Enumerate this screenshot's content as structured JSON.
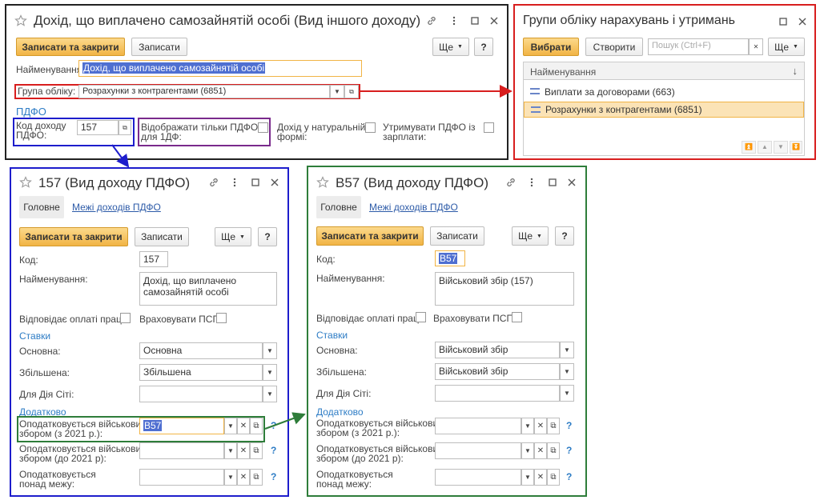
{
  "main_window": {
    "title": "Дохід, що виплачено самозайнятій особі (Вид іншого доходу)",
    "save_close": "Записати та закрити",
    "save": "Записати",
    "more": "Ще",
    "help": "?",
    "name_label": "Найменування:",
    "name_value": "Дохід, що виплачено самозайнятій особі",
    "group_label": "Група обліку:",
    "group_value": "Розрахунки з контрагентами (6851)",
    "pdfo_section": "ПДФО",
    "pdfo_code_label_1": "Код доходу",
    "pdfo_code_label_2": "ПДФО:",
    "pdfo_code_value": "157",
    "show_only_label_1": "Відображати тільки ПДФО",
    "show_only_label_2": "для 1ДФ:",
    "natural_label_1": "Дохід у натуральній",
    "natural_label_2": "формі:",
    "withhold_label_1": "Утримувати ПДФО із",
    "withhold_label_2": "зарплати:"
  },
  "groups_window": {
    "title": "Групи обліку нарахувань і утримань",
    "select": "Вибрати",
    "create": "Створити",
    "search_placeholder": "Пошук (Ctrl+F)",
    "more": "Ще",
    "column": "Найменування",
    "rows": [
      {
        "label": "Виплати за договорами (663)"
      },
      {
        "label": "Розрахунки з контрагентами (6851)"
      }
    ]
  },
  "win157": {
    "title": "157 (Вид доходу ПДФО)",
    "tab_main": "Головне",
    "tab_limits": "Межі доходів ПДФО",
    "save_close": "Записати та закрити",
    "save": "Записати",
    "more": "Ще",
    "help": "?",
    "code_label": "Код:",
    "code_value": "157",
    "name_label": "Найменування:",
    "name_line1": "Дохід, що виплачено",
    "name_line2": "самозайнятій особі",
    "wage_label": "Відповідає оплаті праці:",
    "psp_label": "Враховувати ПСП:",
    "rates_section": "Ставки",
    "basic_label": "Основна:",
    "basic_value": "Основна",
    "increased_label": "Збільшена:",
    "increased_value": "Збільшена",
    "diya_label": "Для Дія Сіті:",
    "extra_section": "Додатково",
    "mil2021_label_1": "Оподатковується військовим",
    "mil2021_label_2": "збором (з 2021 р.):",
    "mil2021_value": "В57",
    "milpre_label_1": "Оподатковується військовим",
    "milpre_label_2": "збором (до 2021 р):",
    "over_label_1": "Оподатковується",
    "over_label_2": "понад межу:"
  },
  "winB57": {
    "title": "В57 (Вид доходу ПДФО)",
    "tab_main": "Головне",
    "tab_limits": "Межі доходів ПДФО",
    "save_close": "Записати та закрити",
    "save": "Записати",
    "more": "Ще",
    "help": "?",
    "code_label": "Код:",
    "code_value": "В57",
    "name_label": "Найменування:",
    "name_line1": "Військовий збір (157)",
    "wage_label": "Відповідає оплаті праці:",
    "psp_label": "Враховувати ПСП:",
    "rates_section": "Ставки",
    "basic_label": "Основна:",
    "basic_value": "Військовий збір",
    "increased_label": "Збільшена:",
    "increased_value": "Військовий збір",
    "diya_label": "Для Дія Сіті:",
    "extra_section": "Додатково",
    "mil2021_label_1": "Оподатковується військовим",
    "mil2021_label_2": "збором (з 2021 р.):",
    "milpre_label_1": "Оподатковується військовим",
    "milpre_label_2": "збором (до 2021 р):",
    "over_label_1": "Оподатковується",
    "over_label_2": "понад межу:"
  },
  "colors": {
    "red": "#d81e1e",
    "blue": "#1d1dcc",
    "purple": "#7a2a8c",
    "green": "#2e7d3a",
    "accent": "#f1b445",
    "link": "#2d7cc5"
  }
}
